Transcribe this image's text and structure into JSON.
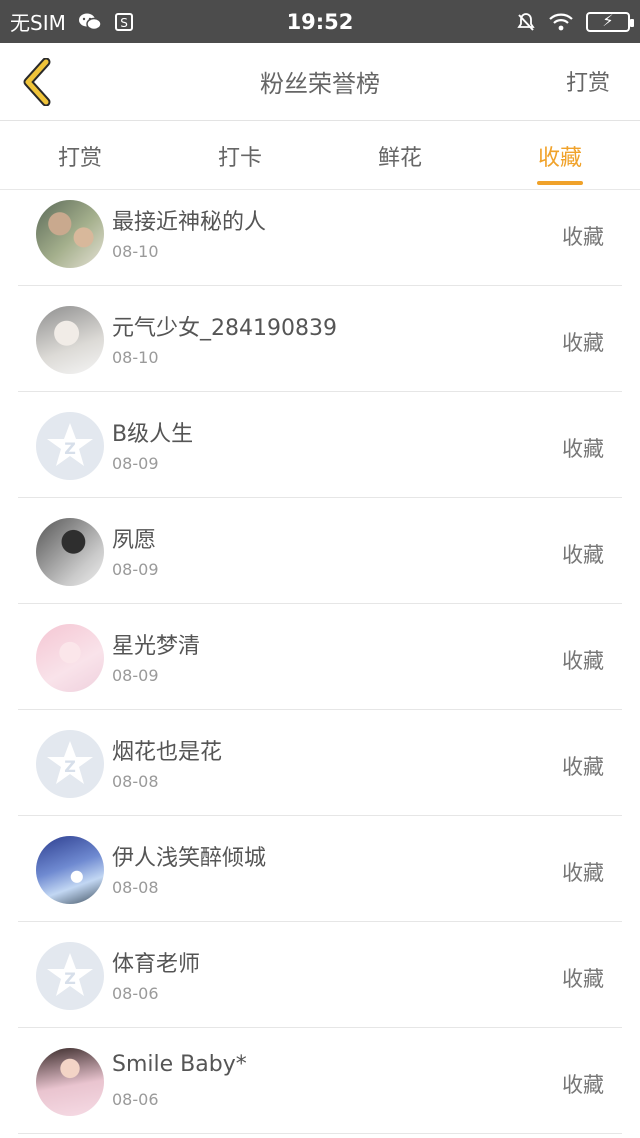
{
  "status_bar": {
    "carrier": "无SIM",
    "time": "19:52",
    "icons": [
      "wechat-icon",
      "s-app-icon",
      "mute-bell-icon",
      "wifi-icon",
      "battery-charging-icon"
    ]
  },
  "header": {
    "title": "粉丝荣誉榜",
    "right_label": "打赏",
    "back_icon": "chevron-left-icon",
    "accent_color": "#f0a22a"
  },
  "tabs": [
    {
      "label": "打赏",
      "active": false
    },
    {
      "label": "打卡",
      "active": false
    },
    {
      "label": "鲜花",
      "active": false
    },
    {
      "label": "收藏",
      "active": true
    }
  ],
  "rows": [
    {
      "name": "最接近神秘的人",
      "date": "08-10",
      "action": "收藏",
      "avatar": "photo"
    },
    {
      "name": "元气少女_284190839",
      "date": "08-10",
      "action": "收藏",
      "avatar": "anime"
    },
    {
      "name": "B级人生",
      "date": "08-09",
      "action": "收藏",
      "avatar": "default-star"
    },
    {
      "name": "夙愿",
      "date": "08-09",
      "action": "收藏",
      "avatar": "dark"
    },
    {
      "name": "星光梦清",
      "date": "08-09",
      "action": "收藏",
      "avatar": "pink-anime"
    },
    {
      "name": "烟花也是花",
      "date": "08-08",
      "action": "收藏",
      "avatar": "default-star"
    },
    {
      "name": "伊人浅笑醉倾城",
      "date": "08-08",
      "action": "收藏",
      "avatar": "sky"
    },
    {
      "name": "体育老师",
      "date": "08-06",
      "action": "收藏",
      "avatar": "default-star"
    },
    {
      "name": "Smile Baby*",
      "date": "08-06",
      "action": "收藏",
      "avatar": "girl"
    }
  ]
}
